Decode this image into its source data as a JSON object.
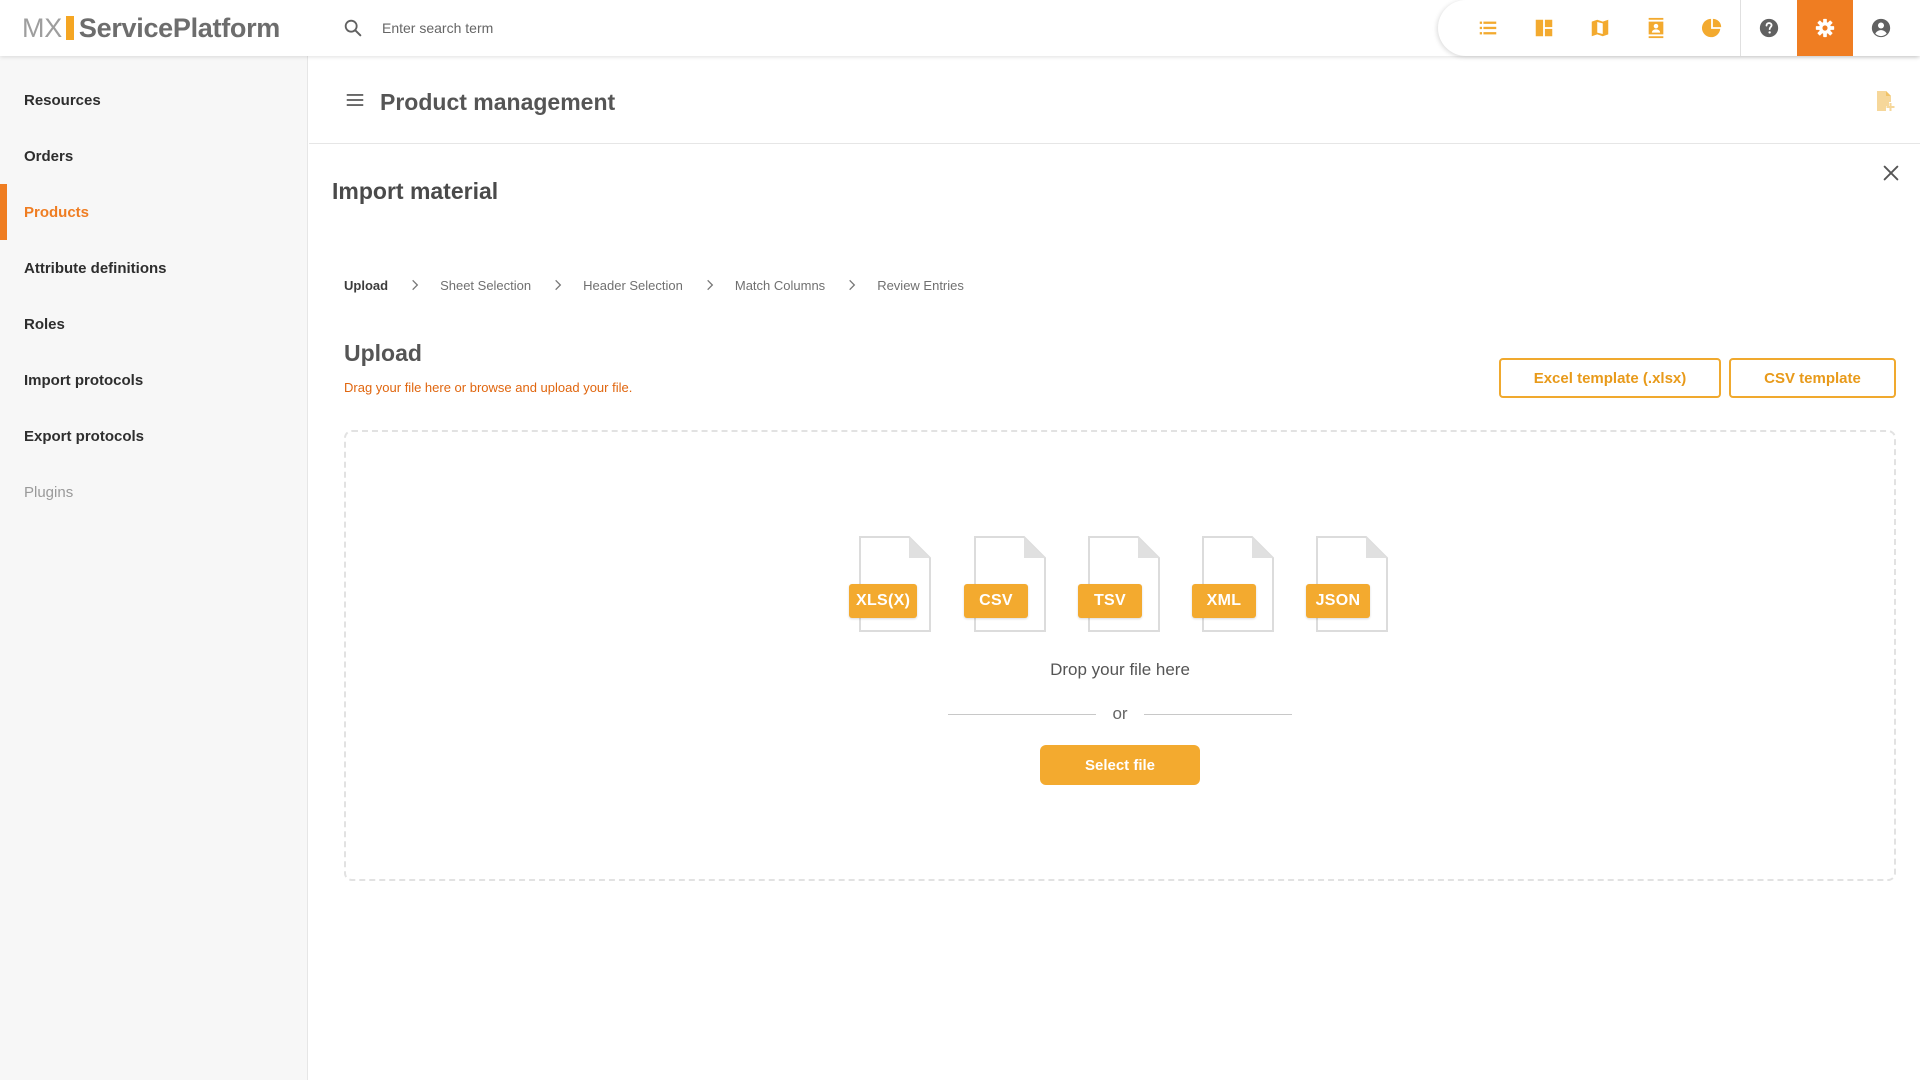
{
  "app": {
    "logo_mx": "MX",
    "logo_name": "ServicePlatform",
    "brand_color": "#f5a623",
    "accent_color": "#ef7d22"
  },
  "search": {
    "placeholder": "Enter search term",
    "value": ""
  },
  "toolbar": {
    "icons": [
      "list-icon",
      "dashboard-icon",
      "map-icon",
      "contacts-icon",
      "pie-chart-icon",
      "help-icon",
      "settings-icon",
      "account-icon"
    ],
    "active": "settings-icon"
  },
  "sidebar": {
    "items": [
      {
        "label": "Resources"
      },
      {
        "label": "Orders"
      },
      {
        "label": "Products"
      },
      {
        "label": "Attribute definitions"
      },
      {
        "label": "Roles"
      },
      {
        "label": "Import protocols"
      },
      {
        "label": "Export protocols"
      },
      {
        "label": "Plugins"
      }
    ],
    "active_index": 2
  },
  "header": {
    "title": "Product management"
  },
  "panel": {
    "title": "Import material"
  },
  "stepper": {
    "steps": [
      "Upload",
      "Sheet Selection",
      "Header Selection",
      "Match Columns",
      "Review Entries"
    ],
    "current_index": 0
  },
  "upload": {
    "title": "Upload",
    "subtitle": "Drag your file here or browse and upload your file.",
    "excel_template_label": "Excel template (.xlsx)",
    "csv_template_label": "CSV template",
    "file_types": [
      "XLS(X)",
      "CSV",
      "TSV",
      "XML",
      "JSON"
    ],
    "drop_text": "Drop your file here",
    "or_text": "or",
    "select_label": "Select file"
  }
}
